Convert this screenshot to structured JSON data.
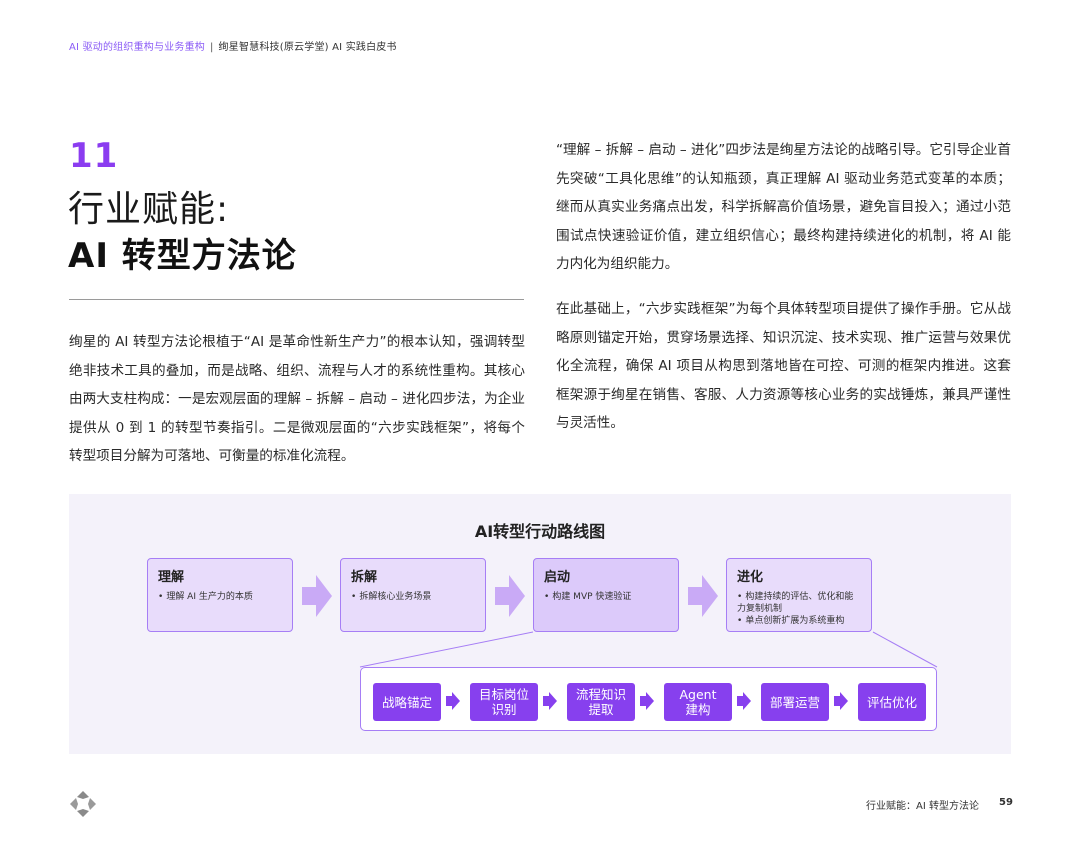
{
  "header": {
    "crumb_section": "AI 驱动的组织重构与业务重构",
    "separator": "|",
    "crumb_book": "绚星智慧科技(原云学堂) AI 实践白皮书"
  },
  "chapter": {
    "number": "11",
    "title_line1": "行业赋能:",
    "title_line2": "AI 转型方法论"
  },
  "left_paragraph": "绚星的 AI 转型方法论根植于“AI 是革命性新生产力”的根本认知，强调转型绝非技术工具的叠加，而是战略、组织、流程与人才的系统性重构。其核心由两大支柱构成：一是宏观层面的理解 – 拆解 – 启动 – 进化四步法，为企业提供从 0 到 1 的转型节奏指引。二是微观层面的“六步实践框架”，将每个转型项目分解为可落地、可衡量的标准化流程。",
  "right_paragraph_1": "“理解 – 拆解 – 启动 – 进化”四步法是绚星方法论的战略引导。它引导企业首先突破“工具化思维”的认知瓶颈，真正理解 AI 驱动业务范式变革的本质；继而从真实业务痛点出发，科学拆解高价值场景，避免盲目投入；通过小范围试点快速验证价值，建立组织信心；最终构建持续进化的机制，将 AI 能力内化为组织能力。",
  "right_paragraph_2": "在此基础上，“六步实践框架”为每个具体转型项目提供了操作手册。它从战略原则锚定开始，贯穿场景选择、知识沉淀、技术实现、推广运营与效果优化全流程，确保 AI 项目从构思到落地皆在可控、可测的框架内推进。这套框架源于绚星在销售、客服、人力资源等核心业务的实战锤炼，兼具严谨性与灵活性。",
  "diagram": {
    "title": "AI转型行动路线图",
    "stages": [
      {
        "title": "理解",
        "items": [
          "理解 AI 生产力的本质"
        ]
      },
      {
        "title": "拆解",
        "items": [
          "拆解核心业务场景"
        ]
      },
      {
        "title": "启动",
        "items": [
          "构建 MVP 快速验证"
        ]
      },
      {
        "title": "进化",
        "items": [
          "构建持续的评估、优化和能力复制机制",
          "单点创新扩展为系统重构"
        ]
      }
    ],
    "bullet": "•",
    "steps": [
      "战略锚定",
      "目标岗位\n识别",
      "流程知识\n提取",
      "Agent\n建构",
      "部署运营",
      "评估优化"
    ]
  },
  "footer": {
    "title": "行业赋能：AI 转型方法论",
    "page": "59"
  },
  "colors": {
    "accent": "#8740ee",
    "stage_fill": "#e8dcfb",
    "stage_border": "#a67ef5",
    "diagram_bg": "#f4f2fa"
  }
}
